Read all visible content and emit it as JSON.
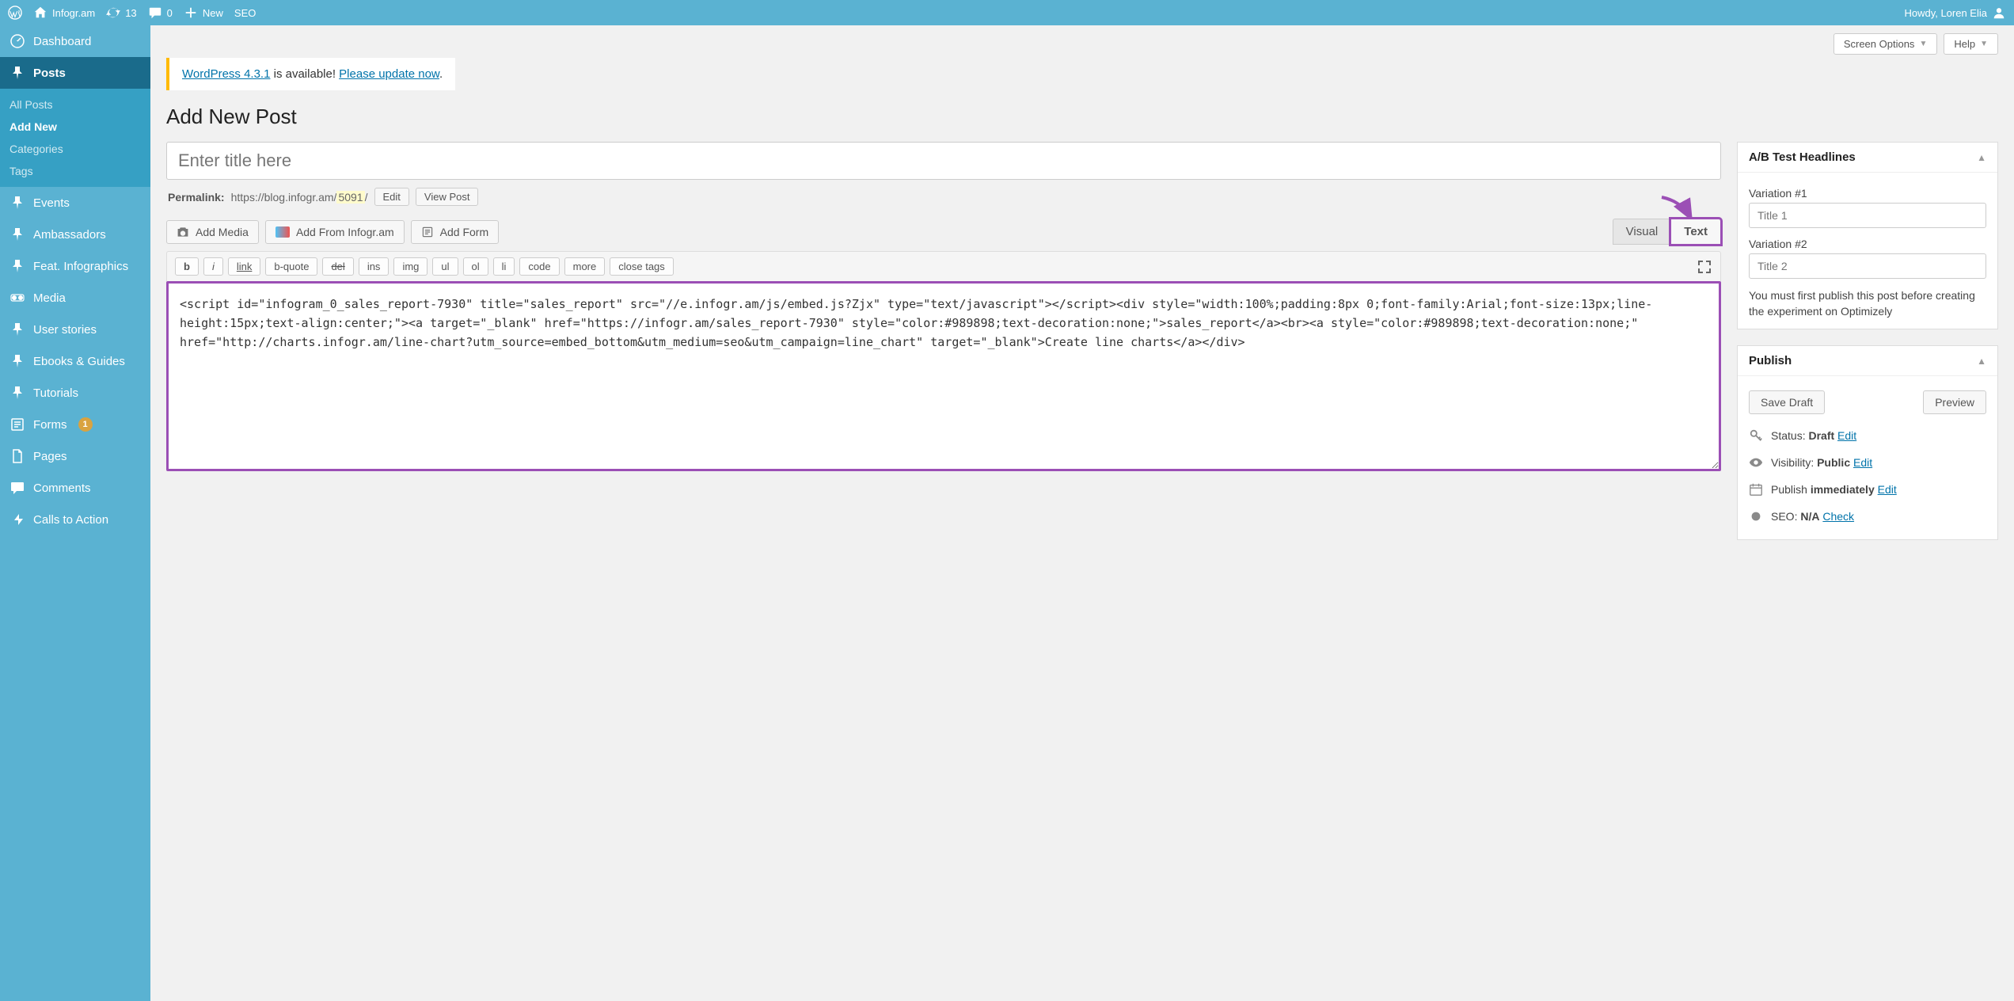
{
  "adminbar": {
    "site_name": "Infogr.am",
    "update_count": "13",
    "comment_count": "0",
    "new_label": "New",
    "seo_label": "SEO",
    "howdy": "Howdy, Loren Elia"
  },
  "sidebar": {
    "items": [
      {
        "icon": "dashboard",
        "label": "Dashboard"
      },
      {
        "icon": "pin",
        "label": "Posts",
        "current": true
      },
      {
        "icon": "pin",
        "label": "Events"
      },
      {
        "icon": "pin",
        "label": "Ambassadors"
      },
      {
        "icon": "pin",
        "label": "Feat. Infographics"
      },
      {
        "icon": "media",
        "label": "Media"
      },
      {
        "icon": "pin",
        "label": "User stories"
      },
      {
        "icon": "pin",
        "label": "Ebooks & Guides"
      },
      {
        "icon": "pin",
        "label": "Tutorials"
      },
      {
        "icon": "form",
        "label": "Forms",
        "badge": "1"
      },
      {
        "icon": "page",
        "label": "Pages"
      },
      {
        "icon": "comment",
        "label": "Comments"
      },
      {
        "icon": "action",
        "label": "Calls to Action"
      }
    ],
    "submenu": {
      "items": [
        "All Posts",
        "Add New",
        "Categories",
        "Tags"
      ],
      "current": "Add New"
    }
  },
  "top_tabs": {
    "screen_options": "Screen Options",
    "help": "Help"
  },
  "update_notice": {
    "prefix": "WordPress 4.3.1",
    "middle": " is available! ",
    "link": "Please update now",
    "suffix": "."
  },
  "page_title": "Add New Post",
  "title_placeholder": "Enter title here",
  "permalink": {
    "label": "Permalink:",
    "base": "https://blog.infogr.am/",
    "slug": "5091",
    "edit": "Edit",
    "view": "View Post"
  },
  "media_buttons": {
    "add_media": "Add Media",
    "add_infogram": "Add From Infogr.am",
    "add_form": "Add Form"
  },
  "editor_tabs": {
    "visual": "Visual",
    "text": "Text"
  },
  "quicktags": [
    "b",
    "i",
    "link",
    "b-quote",
    "del",
    "ins",
    "img",
    "ul",
    "ol",
    "li",
    "code",
    "more",
    "close tags"
  ],
  "editor_content": "<script id=\"infogram_0_sales_report-7930\" title=\"sales_report\" src=\"//e.infogr.am/js/embed.js?Zjx\" type=\"text/javascript\"></script><div style=\"width:100%;padding:8px 0;font-family:Arial;font-size:13px;line-height:15px;text-align:center;\"><a target=\"_blank\" href=\"https://infogr.am/sales_report-7930\" style=\"color:#989898;text-decoration:none;\">sales_report</a><br><a style=\"color:#989898;text-decoration:none;\" href=\"http://charts.infogr.am/line-chart?utm_source=embed_bottom&utm_medium=seo&utm_campaign=line_chart\" target=\"_blank\">Create line charts</a></div>",
  "abtest": {
    "title": "A/B Test Headlines",
    "var1_label": "Variation #1",
    "var1_placeholder": "Title 1",
    "var2_label": "Variation #2",
    "var2_placeholder": "Title 2",
    "note": "You must first publish this post before creating the experiment on Optimizely"
  },
  "publish": {
    "title": "Publish",
    "save_draft": "Save Draft",
    "preview": "Preview",
    "status_label": "Status:",
    "status_value": "Draft",
    "visibility_label": "Visibility:",
    "visibility_value": "Public",
    "schedule_prefix": "Publish",
    "schedule_value": "immediately",
    "seo_label": "SEO:",
    "seo_value": "N/A",
    "edit": "Edit",
    "check": "Check"
  }
}
